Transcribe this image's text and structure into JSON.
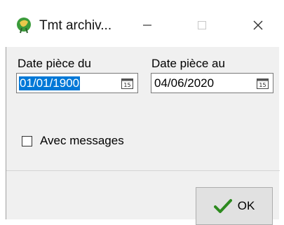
{
  "window": {
    "title": "Tmt archiv...",
    "app_icon": "app-icon",
    "controls": {
      "minimize": "minimize-icon",
      "maximize": "maximize-icon",
      "close": "close-icon"
    }
  },
  "form": {
    "date_from": {
      "label": "Date pièce du",
      "value": "01/01/1900",
      "icon": "calendar-icon"
    },
    "date_to": {
      "label": "Date pièce au",
      "value": "04/06/2020",
      "icon": "calendar-icon"
    },
    "with_messages": {
      "label": "Avec messages",
      "checked": false
    }
  },
  "buttons": {
    "ok": {
      "label": "OK",
      "icon": "checkmark-icon",
      "icon_color": "#2d8a1f"
    }
  },
  "colors": {
    "selection": "#0078d7",
    "client_bg": "#f0f0f0",
    "titlebar_bg": "#ffffff"
  }
}
